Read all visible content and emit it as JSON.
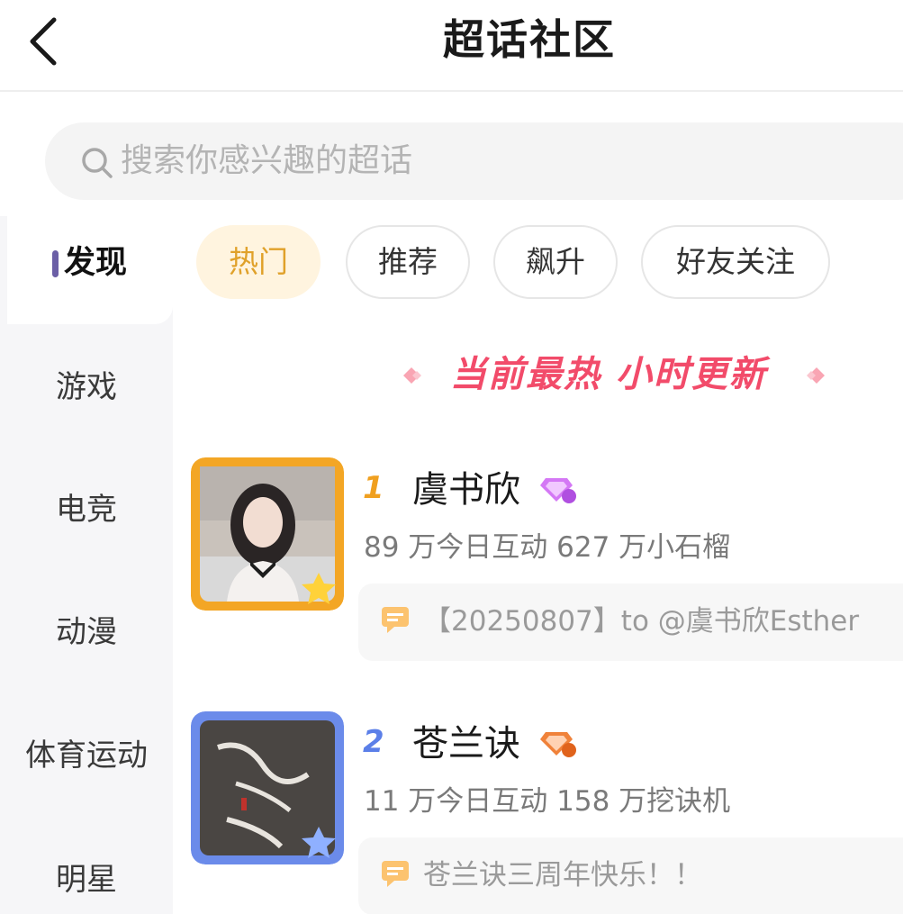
{
  "header": {
    "title": "超话社区"
  },
  "search": {
    "placeholder": "搜索你感兴趣的超话"
  },
  "sidebar": {
    "items": [
      {
        "label": "发现",
        "active": true
      },
      {
        "label": "游戏"
      },
      {
        "label": "电竞"
      },
      {
        "label": "动漫"
      },
      {
        "label": "体育运动"
      },
      {
        "label": "明星"
      }
    ]
  },
  "tabs": [
    {
      "label": "热门",
      "active": true
    },
    {
      "label": "推荐"
    },
    {
      "label": "飙升"
    },
    {
      "label": "好友关注"
    }
  ],
  "banner": {
    "text": "当前最热 小时更新"
  },
  "ranking": [
    {
      "rank": "1",
      "name": "虞书欣",
      "level_icon": "diamond-level-badge",
      "stats": "89 万今日互动 627 万小石榴",
      "post": "【20250807】to @虞书欣Esther"
    },
    {
      "rank": "2",
      "name": "苍兰诀",
      "level_icon": "diamond-level-badge",
      "stats": "11 万今日互动 158 万挖诀机",
      "post": "苍兰诀三周年快乐！！"
    }
  ],
  "colors": {
    "accent_tab_bg": "#fff4df",
    "accent_tab_text": "#e0a12a",
    "banner": "#f24b6a",
    "rank1": "#f0a020",
    "rank2": "#5b7fe8"
  }
}
